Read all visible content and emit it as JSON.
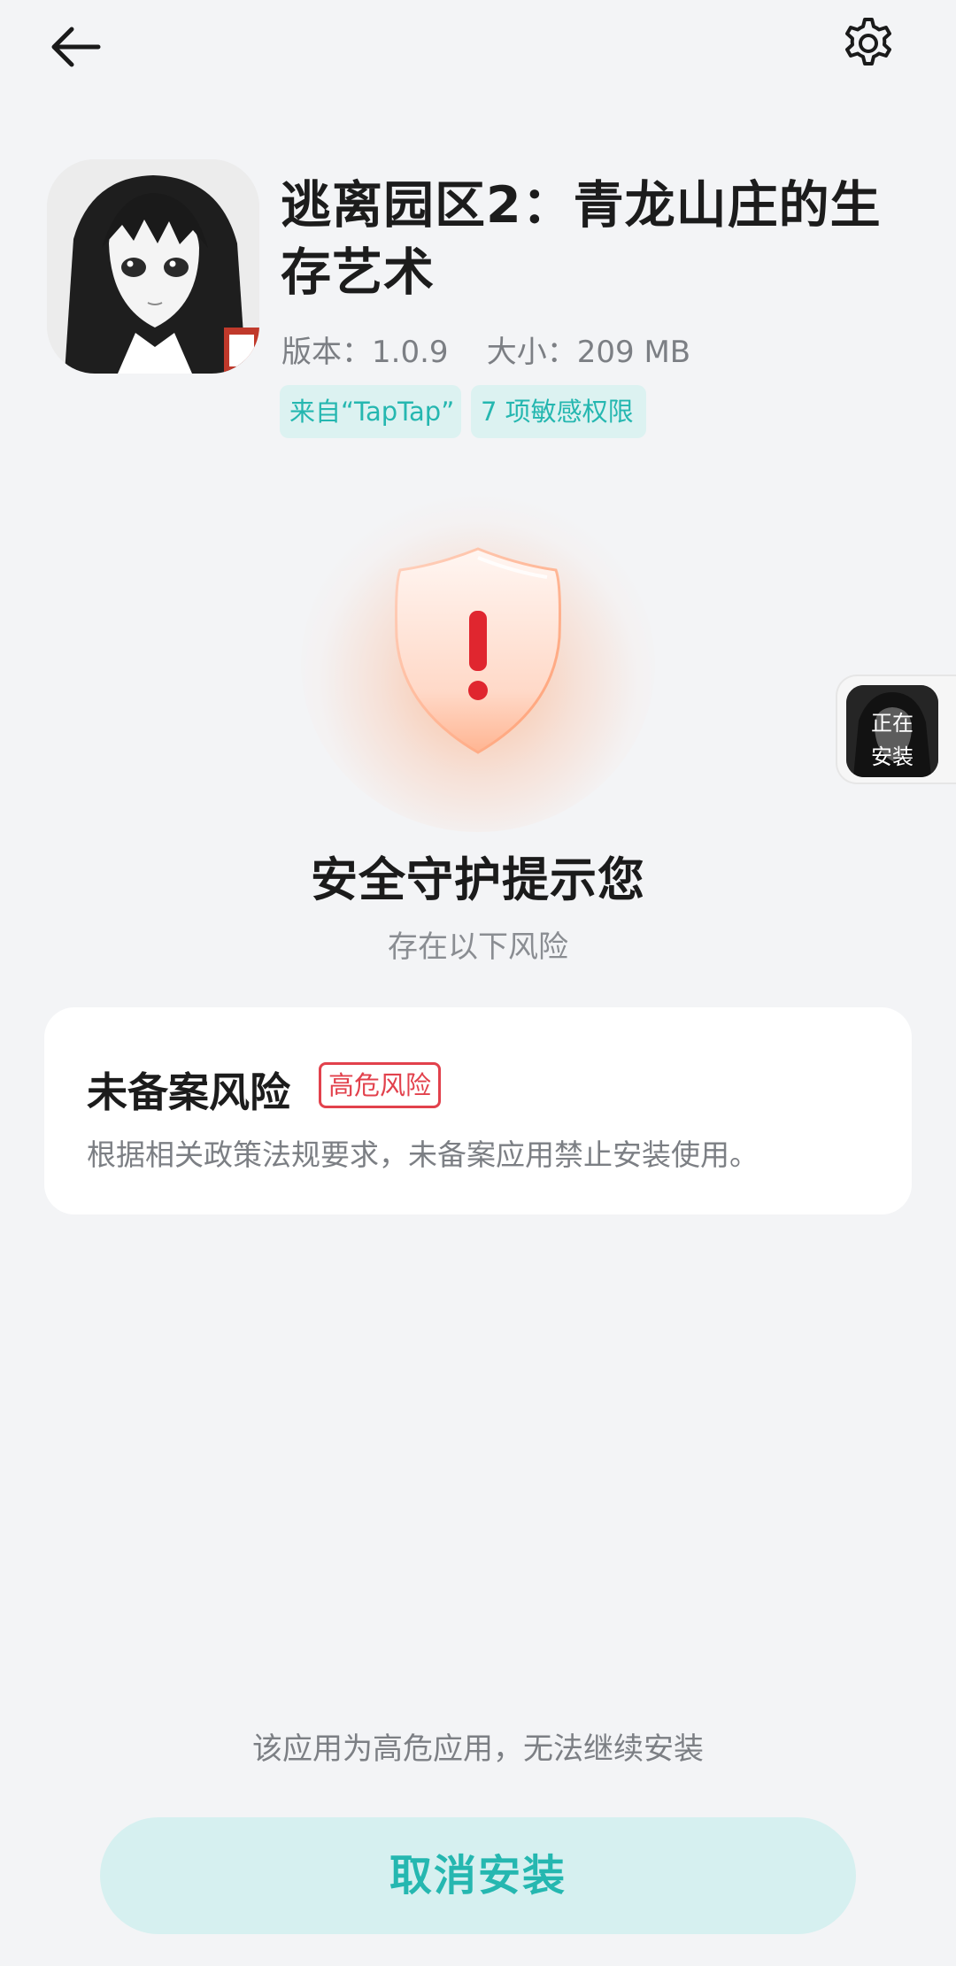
{
  "header": {
    "back_icon": "arrow-left-icon",
    "settings_icon": "gear-icon"
  },
  "app": {
    "title": "逃离园区2：青龙山庄的生存艺术",
    "meta": "版本：1.0.9    大小：209 MB",
    "tags": {
      "source": "来自“TapTap”",
      "permissions": "7 项敏感权限"
    }
  },
  "security": {
    "icon": "shield-alert-icon",
    "title": "安全守护提示您",
    "subtitle": "存在以下风险"
  },
  "risk_card": {
    "title": "未备案风险",
    "badge": "高危风险",
    "description": "根据相关政策法规要求，未备案应用禁止安装使用。"
  },
  "installing_widget": {
    "label": "正在安装"
  },
  "footer": {
    "note": "该应用为高危应用，无法继续安装",
    "cancel_label": "取消安装"
  },
  "colors": {
    "accent": "#25b7b0",
    "accent_bg": "#dcf2f1",
    "danger": "#e2414c",
    "background": "#f3f4f6"
  }
}
